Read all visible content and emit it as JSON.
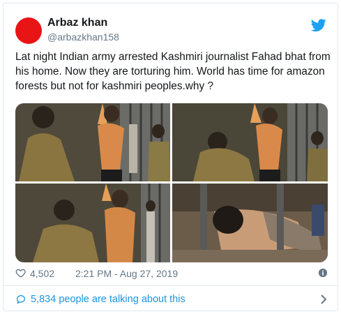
{
  "author": {
    "display_name": "Arbaz khan",
    "handle": "@arbazkhan158",
    "avatar_color": "#e81416"
  },
  "tweet": {
    "text": "Lat night Indian army arrested Kashmiri journalist Fahad bhat from his home. Now they are torturing him. World has time for amazon forests but not for kashmiri peoples.why ?"
  },
  "media": {
    "photo_count": 4
  },
  "stats": {
    "likes": "4,502",
    "timestamp": "2:21 PM - Aug 27, 2019"
  },
  "footer": {
    "talking_label": "5,834 people are talking about this"
  },
  "colors": {
    "link_blue": "#1b95e0",
    "twitter_blue": "#1da1f2",
    "secondary_text": "#657786",
    "border": "#e1e8ed"
  },
  "icons": {
    "brand": "twitter-bird-icon",
    "like": "heart-icon",
    "info": "info-icon",
    "conversation": "speech-bubble-icon",
    "more": "chevron-right-icon"
  }
}
